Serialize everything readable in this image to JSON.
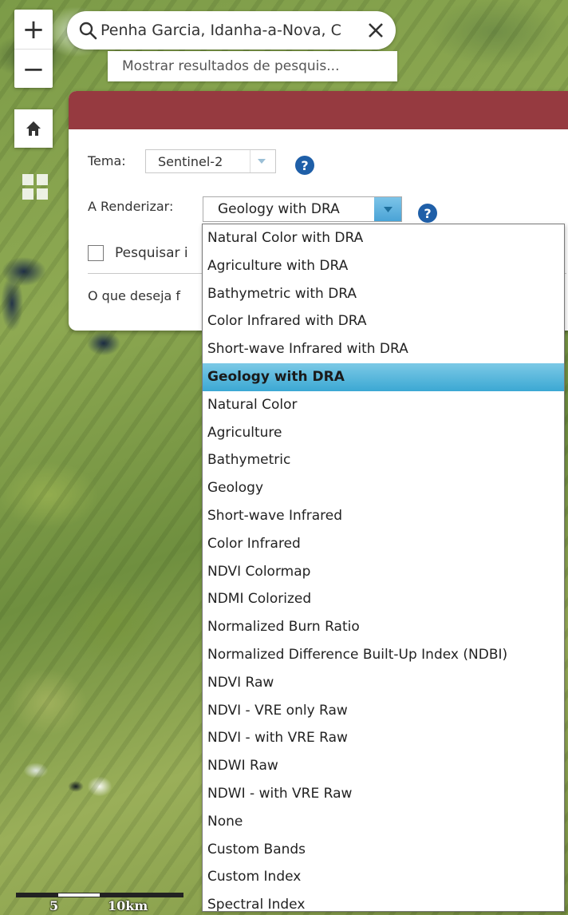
{
  "map": {
    "zoom_in": "+",
    "zoom_out": "−",
    "scale_labels": [
      "5",
      "10km"
    ]
  },
  "search": {
    "value": "Penha Garcia, Idanha-a-Nova, C",
    "results_link": "Mostrar resultados de pesquis..."
  },
  "panel": {
    "header_color": "#963a40",
    "theme_label": "Tema:",
    "theme_value": "Sentinel-2",
    "render_label": "A Renderizar:",
    "render_value": "Geology with DRA",
    "search_images_label": "Pesquisar i",
    "question": "O que deseja f",
    "help": "?"
  },
  "dropdown": {
    "selected_index": 5,
    "accent": "#3ba8d3",
    "options": [
      "Natural Color with DRA",
      "Agriculture with DRA",
      "Bathymetric with DRA",
      "Color Infrared with DRA",
      "Short-wave Infrared with DRA",
      "Geology with DRA",
      "Natural Color",
      "Agriculture",
      "Bathymetric",
      "Geology",
      "Short-wave Infrared",
      "Color Infrared",
      "NDVI Colormap",
      "NDMI Colorized",
      "Normalized Burn Ratio",
      "Normalized Difference Built-Up Index (NDBI)",
      "NDVI Raw",
      "NDVI - VRE only Raw",
      "NDVI - with VRE Raw",
      "NDWI Raw",
      "NDWI - with VRE Raw",
      "None",
      "Custom Bands",
      "Custom Index",
      "Spectral Index"
    ]
  }
}
